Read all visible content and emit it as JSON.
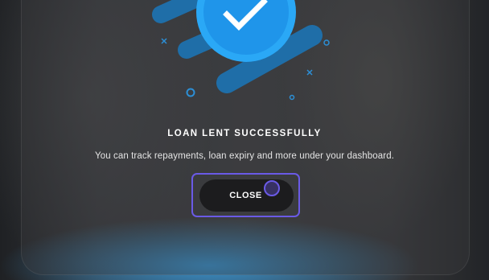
{
  "dialog": {
    "title": "LOAN LENT SUCCESSFULLY",
    "message": "You can track repayments, loan expiry and more under your dashboard.",
    "close_label": "CLOSE"
  },
  "icons": {
    "success": "checkmark-circle-icon",
    "decor": [
      "cross-icon",
      "cross-icon",
      "ring-icon",
      "ring-icon",
      "ring-icon"
    ]
  },
  "colors": {
    "accent": "#1f95ea",
    "accent_light": "#2aa8f6",
    "accent_dim": "#1f6ea8",
    "focus": "#6a5ae6",
    "button_bg": "#1c1c1e",
    "text": "#ffffff"
  }
}
